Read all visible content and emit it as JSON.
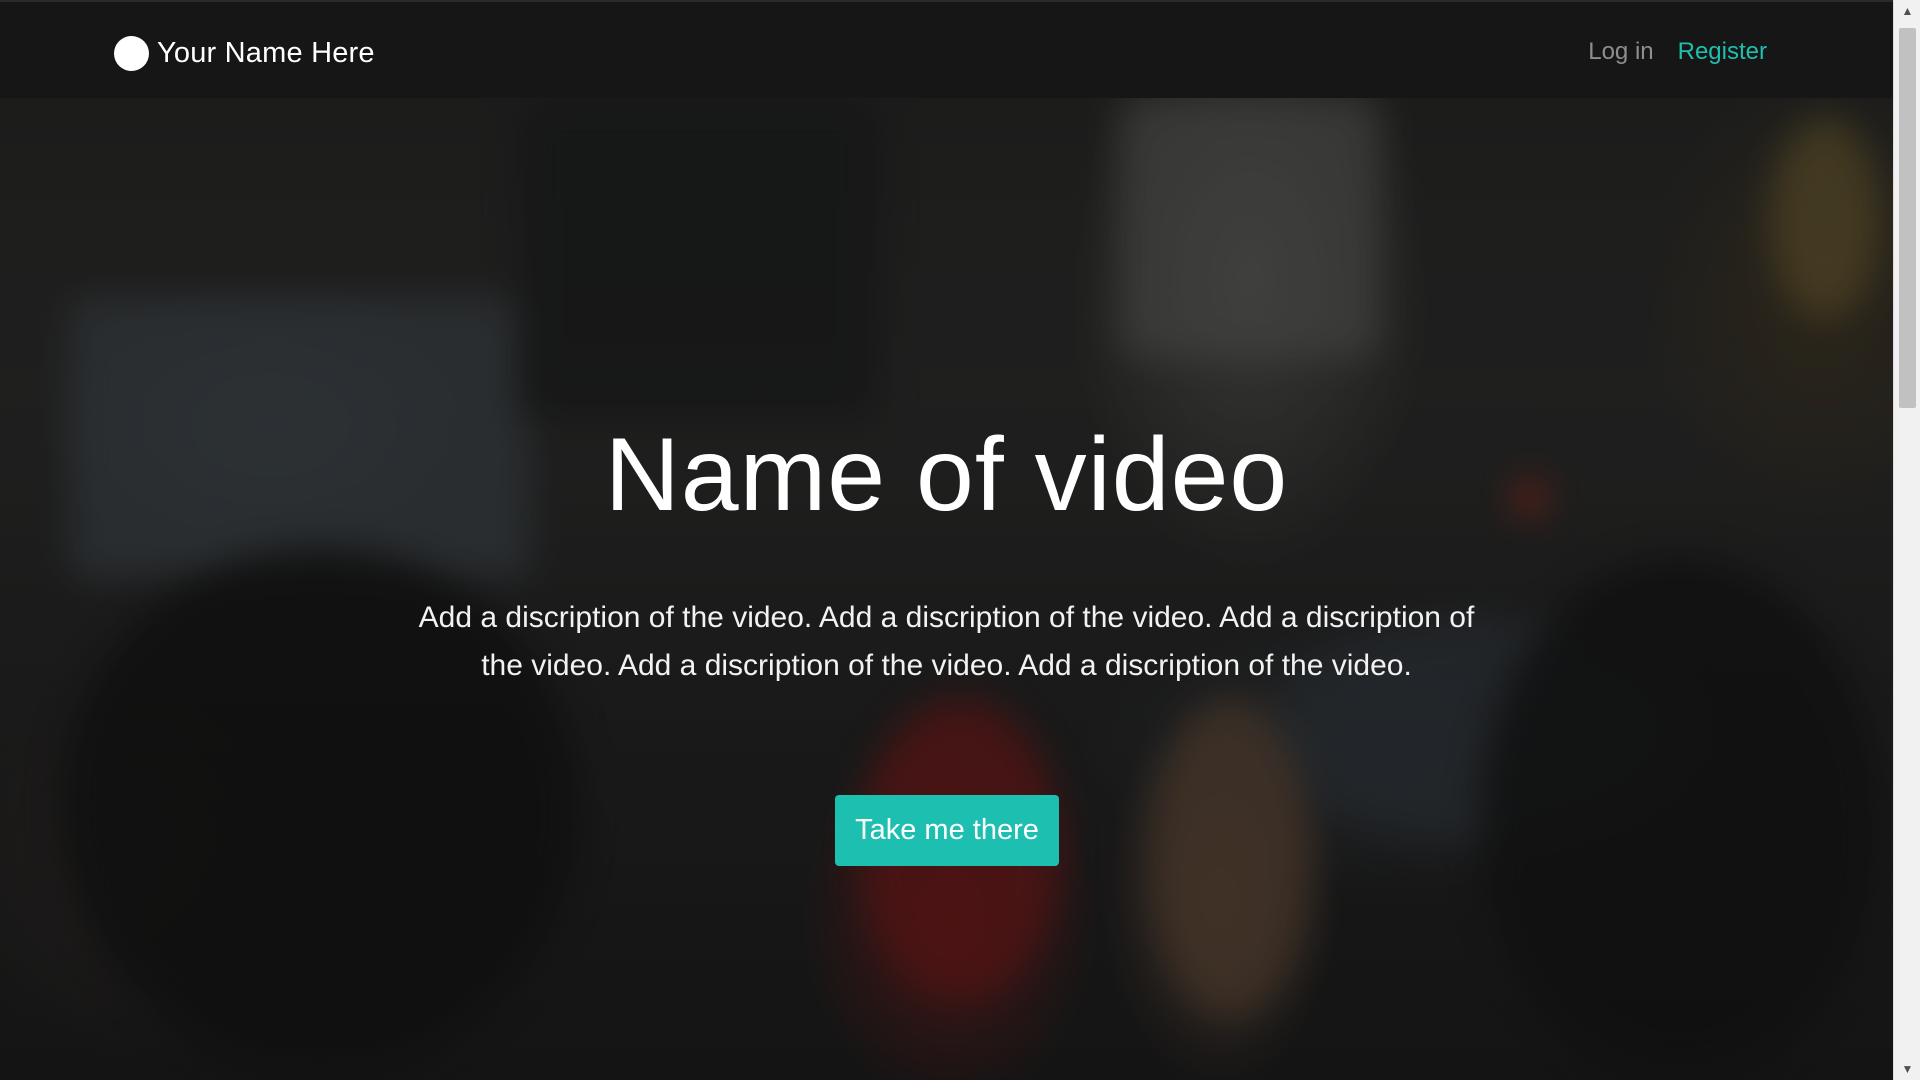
{
  "nav": {
    "brand_name": "Your Name Here",
    "login_label": "Log in",
    "register_label": "Register"
  },
  "hero": {
    "title": "Name of video",
    "description": "Add a discription of the video. Add a discription of the video. Add a discription of the video. Add a discription of the video. Add a discription of the video.",
    "button_label": "Take me there"
  },
  "scrollbar": {
    "up_icon": "▲",
    "down_icon": "▼"
  },
  "colors": {
    "accent": "#1cbfb0",
    "register_link": "#1fbfae",
    "login_link": "#8e8e8e",
    "navbar_bg": "#161616"
  },
  "icons": {
    "brand_logo": "circle-logo-icon",
    "scroll_up": "chevron-up-icon",
    "scroll_down": "chevron-down-icon"
  }
}
